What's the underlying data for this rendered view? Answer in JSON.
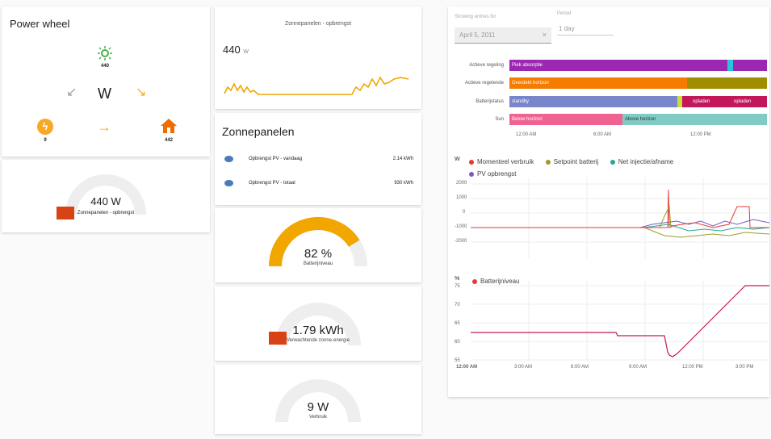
{
  "power_wheel": {
    "title": "Power wheel",
    "center_unit": "W",
    "solar_value": "440",
    "battery_value": "9",
    "home_value": "442"
  },
  "solar_gauge_card": {
    "value": "440 W",
    "label": "Zonnepanelen - opbrengst"
  },
  "solar_graph_card": {
    "title": "Zonnepanelen - opbrengst",
    "value": "440",
    "unit": "W"
  },
  "entities_card": {
    "title": "Zonnepanelen",
    "rows": [
      {
        "name": "Opbrengst PV - vandaag",
        "value": "2.14 kWh"
      },
      {
        "name": "Opbrengst PV - totaal",
        "value": "930 kWh"
      }
    ]
  },
  "battery_gauge": {
    "value": "82 %",
    "label": "Batterijniveau",
    "level": 0.82
  },
  "energy_gauge": {
    "value": "1.79 kWh",
    "label": "Verwachtende zonne-energie"
  },
  "usage_gauge": {
    "value": "9 W",
    "label": "Verbruik"
  },
  "history": {
    "date_field_label": "Showing entries for",
    "date_value": "April 5, 2011",
    "period_label": "Period",
    "period_value": "1 day",
    "timeline_rows": [
      {
        "label": "Actieve regeling",
        "segments": [
          {
            "text": "Piek absorptie",
            "color": "#9c27b0"
          }
        ]
      },
      {
        "label": "Actieve regelende",
        "segments": [
          {
            "text": "Overdekt horizon",
            "color": "#f57c00"
          }
        ]
      },
      {
        "label": "Batterijstatus",
        "segments": [
          {
            "text": "standby",
            "color": "#7986cb"
          },
          {
            "text": "opladen",
            "color": "#c2185b"
          },
          {
            "text": "opladen",
            "color": "#c2185b"
          }
        ]
      },
      {
        "label": "Sun",
        "segments": [
          {
            "text": "Below horizon",
            "color": "#f06292"
          },
          {
            "text": "Above horizon",
            "color": "#80cbc4"
          }
        ]
      }
    ],
    "timeline_ticks": [
      "12:00 AM",
      "6:00 AM",
      "12:00 PM"
    ],
    "power_chart": {
      "unit": "W",
      "legend": [
        {
          "name": "Momenteel verbruik",
          "color": "#e53935"
        },
        {
          "name": "Setpoint batterij",
          "color": "#9e9d24"
        },
        {
          "name": "Net injectie/afname",
          "color": "#26a69a"
        },
        {
          "name": "PV opbrengst",
          "color": "#7e57c2"
        }
      ],
      "y_ticks": [
        "2000",
        "1000",
        "0",
        "-1000",
        "-2000"
      ]
    },
    "battery_chart": {
      "unit": "%",
      "legend": [
        {
          "name": "Batterijniveau",
          "color": "#e53935"
        }
      ],
      "y_ticks": [
        "75",
        "70",
        "65",
        "60",
        "55"
      ],
      "x_ticks": [
        "12:00 AM",
        "3:00 AM",
        "6:00 AM",
        "9:00 AM",
        "12:00 PM",
        "3:00 PM"
      ]
    }
  }
}
